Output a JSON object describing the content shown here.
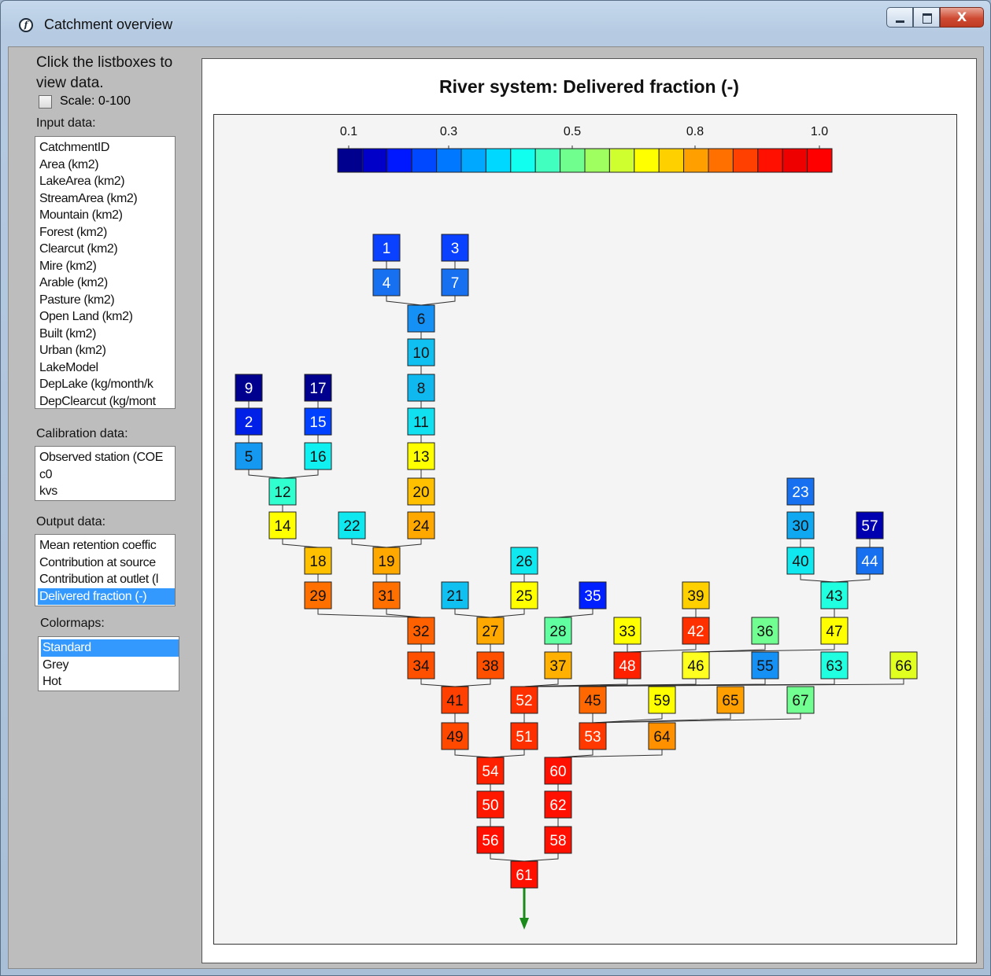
{
  "window": {
    "title": "Catchment overview",
    "close_glyph": "X"
  },
  "sidebar": {
    "intro": "Click the listboxes to view data.",
    "scale_label": "Scale: 0-100",
    "input_label": "Input data:",
    "input_items": [
      "CatchmentID",
      "Area (km2)",
      "LakeArea (km2)",
      "StreamArea (km2)",
      "Mountain (km2)",
      "Forest (km2)",
      "Clearcut (km2)",
      "Mire (km2)",
      "Arable (km2)",
      "Pasture (km2)",
      "Open Land (km2)",
      "Built (km2)",
      "Urban (km2)",
      "LakeModel",
      "DepLake (kg/month/k",
      "DepClearcut (kg/mont"
    ],
    "calibration_label": "Calibration data:",
    "calibration_items": [
      "Observed station (COE",
      "c0",
      "kvs"
    ],
    "output_label": "Output data:",
    "output_items": [
      "Mean retention coeffic",
      "Contribution at source",
      "Contribution at outlet (l",
      "Delivered fraction (-)"
    ],
    "output_selected": 3,
    "colormaps_label": "Colormaps:",
    "colormap_items": [
      "Standard",
      "Grey",
      "Hot"
    ],
    "colormap_selected": 0
  },
  "chart_data": {
    "type": "diagram",
    "title": "River system: Delivered fraction (-)",
    "colorbar": {
      "tick_labels": [
        "0.1",
        "0.3",
        "0.5",
        "0.8",
        "1.0"
      ],
      "colors": [
        "#00008f",
        "#0000c8",
        "#0018ff",
        "#0048ff",
        "#0078ff",
        "#00a8ff",
        "#00d8ff",
        "#10ffef",
        "#40ffbf",
        "#70ff8f",
        "#a0ff60",
        "#d0ff30",
        "#ffff00",
        "#ffd000",
        "#ffa000",
        "#ff7000",
        "#ff4000",
        "#ff1000",
        "#ef0000",
        "#ff0000"
      ]
    },
    "outlet": "61",
    "catchments": [
      {
        "id": "1",
        "color": "#0a40ff"
      },
      {
        "id": "3",
        "color": "#0a40ff"
      },
      {
        "id": "4",
        "color": "#1670f0"
      },
      {
        "id": "7",
        "color": "#1670f0"
      },
      {
        "id": "6",
        "color": "#1590f5"
      },
      {
        "id": "10",
        "color": "#10c0f0"
      },
      {
        "id": "8",
        "color": "#10b8f0"
      },
      {
        "id": "11",
        "color": "#10e0f0"
      },
      {
        "id": "13",
        "color": "#ffff00"
      },
      {
        "id": "20",
        "color": "#ffc000"
      },
      {
        "id": "24",
        "color": "#ffa800"
      },
      {
        "id": "22",
        "color": "#10e8f0"
      },
      {
        "id": "9",
        "color": "#00008f"
      },
      {
        "id": "17",
        "color": "#00008f"
      },
      {
        "id": "2",
        "color": "#0020e8"
      },
      {
        "id": "15",
        "color": "#0040ff"
      },
      {
        "id": "5",
        "color": "#1598f0"
      },
      {
        "id": "16",
        "color": "#10f0f0"
      },
      {
        "id": "12",
        "color": "#30ffd0"
      },
      {
        "id": "14",
        "color": "#ffff00"
      },
      {
        "id": "18",
        "color": "#ffc000"
      },
      {
        "id": "19",
        "color": "#ffa800"
      },
      {
        "id": "26",
        "color": "#10e8f0"
      },
      {
        "id": "29",
        "color": "#ff7000"
      },
      {
        "id": "31",
        "color": "#ff7000"
      },
      {
        "id": "21",
        "color": "#10c0f0"
      },
      {
        "id": "25",
        "color": "#ffff00"
      },
      {
        "id": "35",
        "color": "#0020ff"
      },
      {
        "id": "39",
        "color": "#ffd000"
      },
      {
        "id": "23",
        "color": "#1670f0"
      },
      {
        "id": "30",
        "color": "#10a8f0"
      },
      {
        "id": "57",
        "color": "#0000b0"
      },
      {
        "id": "40",
        "color": "#10e8f0"
      },
      {
        "id": "44",
        "color": "#1670f0"
      },
      {
        "id": "43",
        "color": "#20ffe0"
      },
      {
        "id": "32",
        "color": "#ff6000"
      },
      {
        "id": "27",
        "color": "#ffa800"
      },
      {
        "id": "28",
        "color": "#60ffa0"
      },
      {
        "id": "33",
        "color": "#ffff00"
      },
      {
        "id": "42",
        "color": "#ff3000"
      },
      {
        "id": "36",
        "color": "#70ff90"
      },
      {
        "id": "47",
        "color": "#ffff00"
      },
      {
        "id": "34",
        "color": "#ff5000"
      },
      {
        "id": "38",
        "color": "#ff5000"
      },
      {
        "id": "37",
        "color": "#ffb000"
      },
      {
        "id": "48",
        "color": "#ff2000"
      },
      {
        "id": "46",
        "color": "#ffff20"
      },
      {
        "id": "55",
        "color": "#1590f5"
      },
      {
        "id": "63",
        "color": "#20ffe0"
      },
      {
        "id": "66",
        "color": "#e0ff20"
      },
      {
        "id": "41",
        "color": "#ff4000"
      },
      {
        "id": "52",
        "color": "#ff3000"
      },
      {
        "id": "45",
        "color": "#ff6800"
      },
      {
        "id": "59",
        "color": "#ffff00"
      },
      {
        "id": "65",
        "color": "#ffa000"
      },
      {
        "id": "67",
        "color": "#70ff90"
      },
      {
        "id": "49",
        "color": "#ff4800"
      },
      {
        "id": "51",
        "color": "#ff3000"
      },
      {
        "id": "53",
        "color": "#ff3800"
      },
      {
        "id": "64",
        "color": "#ff9000"
      },
      {
        "id": "54",
        "color": "#ff2000"
      },
      {
        "id": "60",
        "color": "#ff1000"
      },
      {
        "id": "50",
        "color": "#ff1800"
      },
      {
        "id": "62",
        "color": "#ff1000"
      },
      {
        "id": "56",
        "color": "#ff1000"
      },
      {
        "id": "58",
        "color": "#ff1000"
      },
      {
        "id": "61",
        "color": "#ff1000"
      }
    ]
  }
}
